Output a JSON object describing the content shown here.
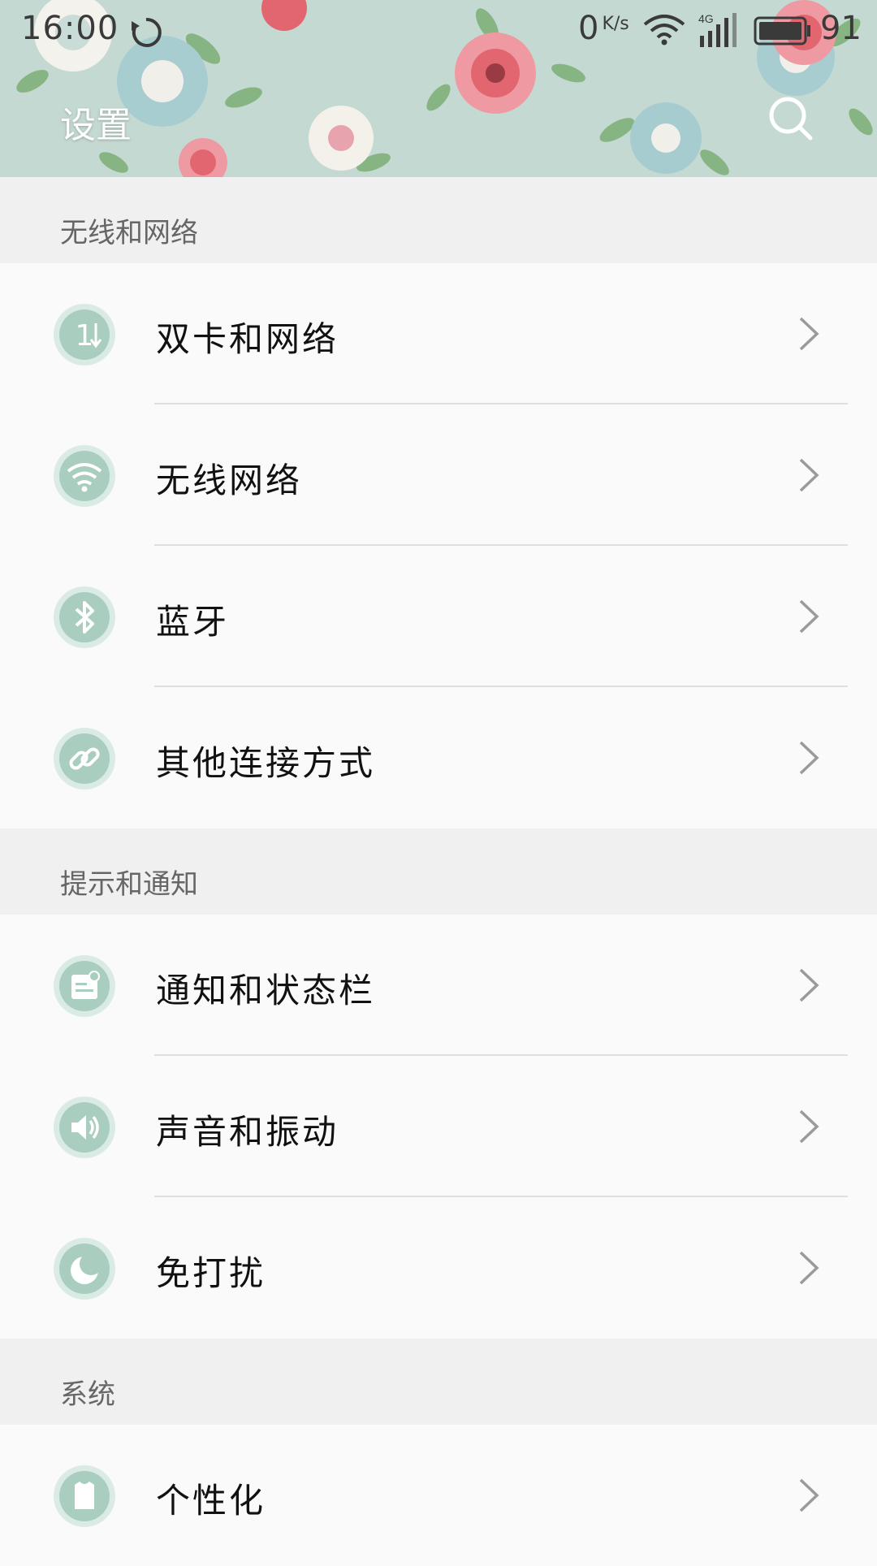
{
  "status_bar": {
    "time": "16:00",
    "net_speed": "0",
    "net_speed_unit": "K/s",
    "network_type": "4G",
    "battery_level": "91"
  },
  "header": {
    "title": "设置"
  },
  "sections": [
    {
      "title": "无线和网络",
      "items": [
        {
          "label": "双卡和网络",
          "icon": "dual-sim-icon"
        },
        {
          "label": "无线网络",
          "icon": "wifi-icon"
        },
        {
          "label": "蓝牙",
          "icon": "bluetooth-icon"
        },
        {
          "label": "其他连接方式",
          "icon": "link-icon"
        }
      ]
    },
    {
      "title": "提示和通知",
      "items": [
        {
          "label": "通知和状态栏",
          "icon": "notification-icon"
        },
        {
          "label": "声音和振动",
          "icon": "speaker-icon"
        },
        {
          "label": "免打扰",
          "icon": "moon-icon"
        }
      ]
    },
    {
      "title": "系统",
      "items": [
        {
          "label": "个性化",
          "icon": "tshirt-icon"
        }
      ]
    }
  ],
  "colors": {
    "icon_fill": "#a9cdbf",
    "icon_ring": "#d9ebe4",
    "header_bg": "#c4d9d4",
    "section_header_bg": "#f0f0f0",
    "list_bg": "#fafafa"
  }
}
